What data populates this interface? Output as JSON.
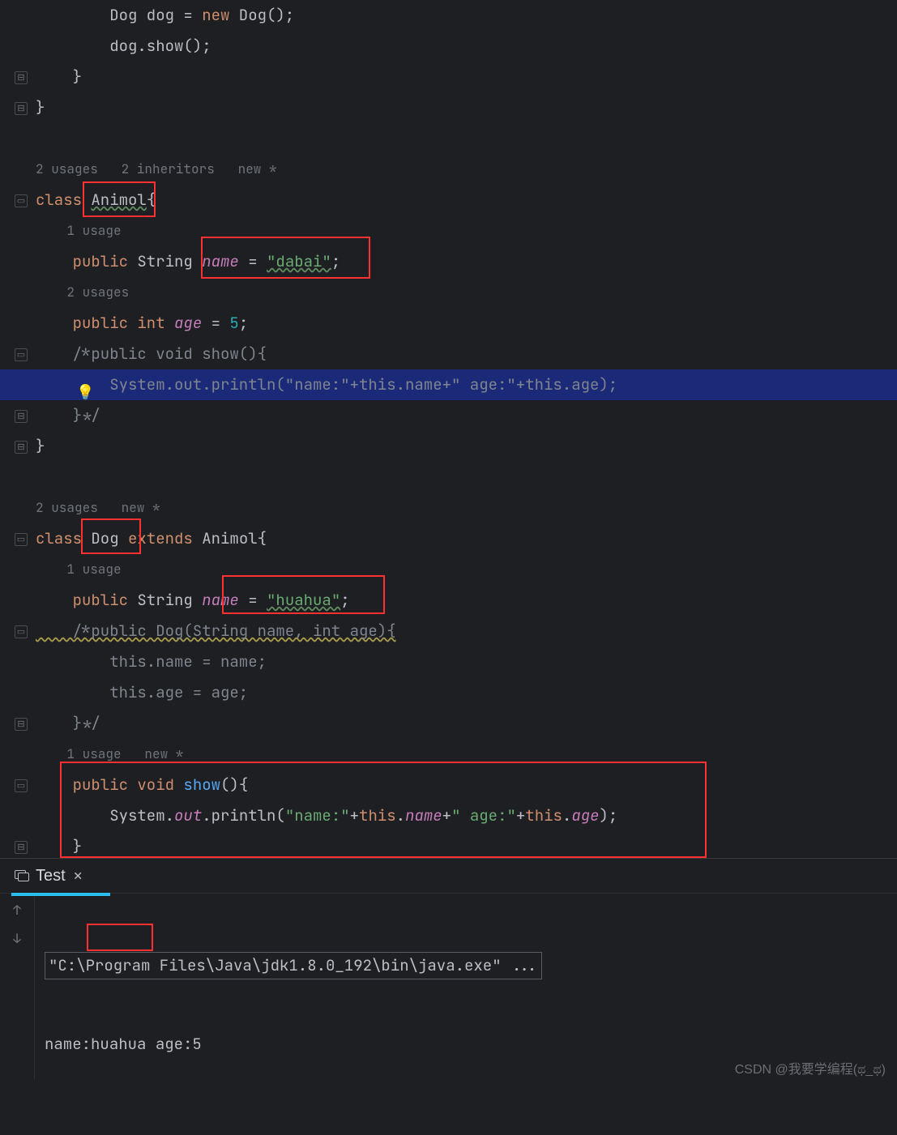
{
  "code": {
    "l1": "        Dog dog = new Dog();",
    "l2": "        dog.show();",
    "l3": "    }",
    "l4": "}",
    "blank": "",
    "hint1": "2 usages   2 inheritors   new *",
    "l5_class": "class ",
    "l5_name": "Animol",
    "l5_brace": "{",
    "hint2": "    1 usage",
    "l6_pub": "    public ",
    "l6_type": "String ",
    "l6_field": "name",
    "l6_eq": " = ",
    "l6_str": "\"dabai\"",
    "l6_semi": ";",
    "hint3": "    2 usages",
    "l7_pub": "    public ",
    "l7_kw": "int ",
    "l7_field": "age",
    "l7_eq": " = ",
    "l7_num": "5",
    "l7_semi": ";",
    "l8": "    /*public void show(){",
    "l9": "        System.out.println(\"name:\"+this.name+\" age:\"+this.age);",
    "l10": "    }*/",
    "l11": "}",
    "hint4": "2 usages   new *",
    "l12_class": "class ",
    "l12_name": "Dog ",
    "l12_ext": "extends ",
    "l12_parent": "Animol{",
    "hint5": "    1 usage",
    "l13_pub": "    public ",
    "l13_type": "String ",
    "l13_field": "name",
    "l13_eq": " = ",
    "l13_str": "\"huahua\"",
    "l13_semi": ";",
    "l14": "    /*public Dog(String name, int age){",
    "l15": "        this.name = name;",
    "l16": "        this.age = age;",
    "l17": "    }*/",
    "hint6": "    1 usage   new *",
    "l18_pub": "    public ",
    "l18_void": "void ",
    "l18_method": "show",
    "l18_paren": "(){",
    "l19_a": "        System.",
    "l19_out": "out",
    "l19_b": ".println(",
    "l19_s1": "\"name:\"",
    "l19_p1": "+",
    "l19_kw1": "this",
    "l19_d1": ".",
    "l19_f1": "name",
    "l19_p2": "+",
    "l19_s2": "\" age:\"",
    "l19_p3": "+",
    "l19_kw2": "this",
    "l19_d2": ".",
    "l19_f2": "age",
    "l19_end": ");",
    "l20": "    }"
  },
  "console": {
    "tab": "Test",
    "cmd": "\"C:\\Program Files\\Java\\jdk1.8.0_192\\bin\\java.exe\" ...",
    "out_prefix": "name:",
    "out_name": "huahua",
    "out_suffix": " age:5"
  },
  "watermark": "CSDN @我要学编程(ಥ_ಥ)"
}
